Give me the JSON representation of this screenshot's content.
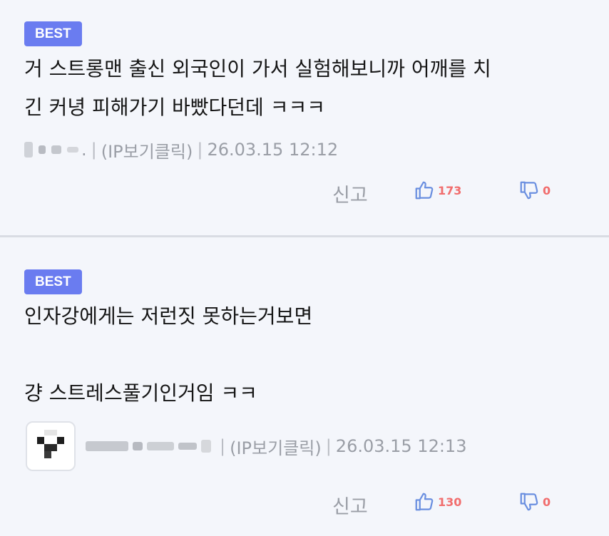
{
  "comments": [
    {
      "badge": "BEST",
      "text": "거 스트롱맨 출신 외국인이 가서 실험해보니까 어깨를 치\n긴 커녕 피해가기 바빴다던데 ㅋㅋㅋ",
      "author": ".",
      "ip_label": "(IP보기클릭)",
      "timestamp": "26.03.15 12:12",
      "report_label": "신고",
      "likes": "173",
      "dislikes": "0"
    },
    {
      "badge": "BEST",
      "text": "인자강에게는 저런짓 못하는거보면\n\n걍 스트레스풀기인거임 ㅋㅋ",
      "author": "",
      "ip_label": "(IP보기클릭)",
      "timestamp": "26.03.15 12:13",
      "report_label": "신고",
      "likes": "130",
      "dislikes": "0"
    }
  ],
  "colors": {
    "badge": "#6a7cf0",
    "like": "#f16d6d",
    "icon": "#6a8fe0",
    "meta": "#9a9ea6"
  },
  "icons": {
    "like": "thumbs-up-icon",
    "dislike": "thumbs-down-icon"
  }
}
